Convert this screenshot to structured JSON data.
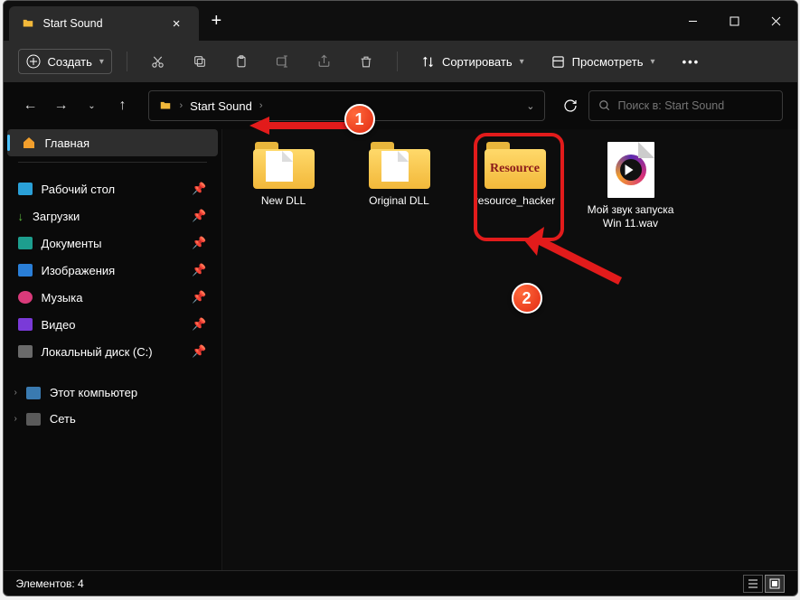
{
  "title": "Start Sound",
  "toolbar": {
    "create": "Создать",
    "sort": "Сортировать",
    "view": "Просмотреть",
    "more": "…"
  },
  "breadcrumb": {
    "item": "Start Sound"
  },
  "search": {
    "placeholder": "Поиск в: Start Sound"
  },
  "sidebar": {
    "home": "Главная",
    "desktop": "Рабочий стол",
    "downloads": "Загрузки",
    "documents": "Документы",
    "pictures": "Изображения",
    "music": "Музыка",
    "videos": "Видео",
    "localdisk": "Локальный диск (C:)",
    "thispc": "Этот компьютер",
    "network": "Сеть"
  },
  "files": {
    "f1": "New DLL",
    "f2": "Original DLL",
    "f3": "resource_hacker",
    "f3_icon_text": "Resource",
    "f4": "Мой звук запуска Win 11.wav"
  },
  "status": {
    "count_label": "Элементов:",
    "count": "4"
  },
  "badges": {
    "b1": "1",
    "b2": "2"
  }
}
